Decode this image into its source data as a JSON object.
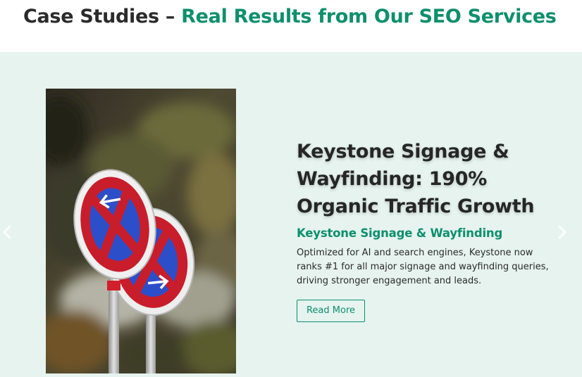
{
  "header": {
    "title_plain": "Case Studies – ",
    "title_accent": "Real Results from Our SEO Services"
  },
  "slide": {
    "heading": "Keystone Signage & Wayfinding: 190% Organic Traffic Growth",
    "subtitle": "Keystone Signage & Wayfinding",
    "description": "Optimized for AI and search engines, Keystone now ranks #1 for all major signage and wayfinding queries, driving stronger engagement and leads.",
    "button_label": "Read More",
    "image_icon": "no-parking-signs-photo"
  },
  "navigation": {
    "prev_icon": "chevron-left-icon",
    "next_icon": "chevron-right-icon"
  },
  "colors": {
    "accent": "#0e8f6d",
    "slider_background": "#e6f3ef",
    "heading": "#262626"
  }
}
